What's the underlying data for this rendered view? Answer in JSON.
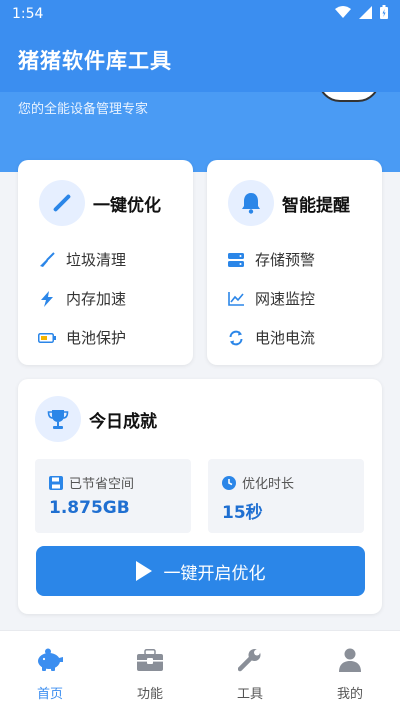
{
  "status_bar": {
    "time": "1:54"
  },
  "app_bar": {
    "title": "猪猪软件库工具"
  },
  "hero": {
    "subtitle": "您的全能设备管理专家"
  },
  "optimize_card": {
    "title": "一键优化",
    "items": [
      {
        "label": "垃圾清理",
        "icon": "broom-icon"
      },
      {
        "label": "内存加速",
        "icon": "lightning-icon"
      },
      {
        "label": "电池保护",
        "icon": "battery-icon"
      }
    ]
  },
  "alert_card": {
    "title": "智能提醒",
    "items": [
      {
        "label": "存储预警",
        "icon": "storage-icon"
      },
      {
        "label": "网速监控",
        "icon": "chart-line-icon"
      },
      {
        "label": "电池电流",
        "icon": "sync-icon"
      }
    ]
  },
  "achievement_card": {
    "title": "今日成就",
    "saved_space": {
      "label": "已节省空间",
      "value": "1.875GB"
    },
    "optimize_time": {
      "label": "优化时长",
      "value": "15秒"
    },
    "cta_label": "一键开启优化"
  },
  "bottom_nav": {
    "items": [
      {
        "label": "首页",
        "icon": "piggy-bank-icon",
        "active": true
      },
      {
        "label": "功能",
        "icon": "toolbox-icon",
        "active": false
      },
      {
        "label": "工具",
        "icon": "wrench-icon",
        "active": false
      },
      {
        "label": "我的",
        "icon": "user-icon",
        "active": false
      }
    ]
  },
  "colors": {
    "primary": "#3b8ef0",
    "accent_dark": "#1f6fd1",
    "background": "#f2f4f8"
  }
}
